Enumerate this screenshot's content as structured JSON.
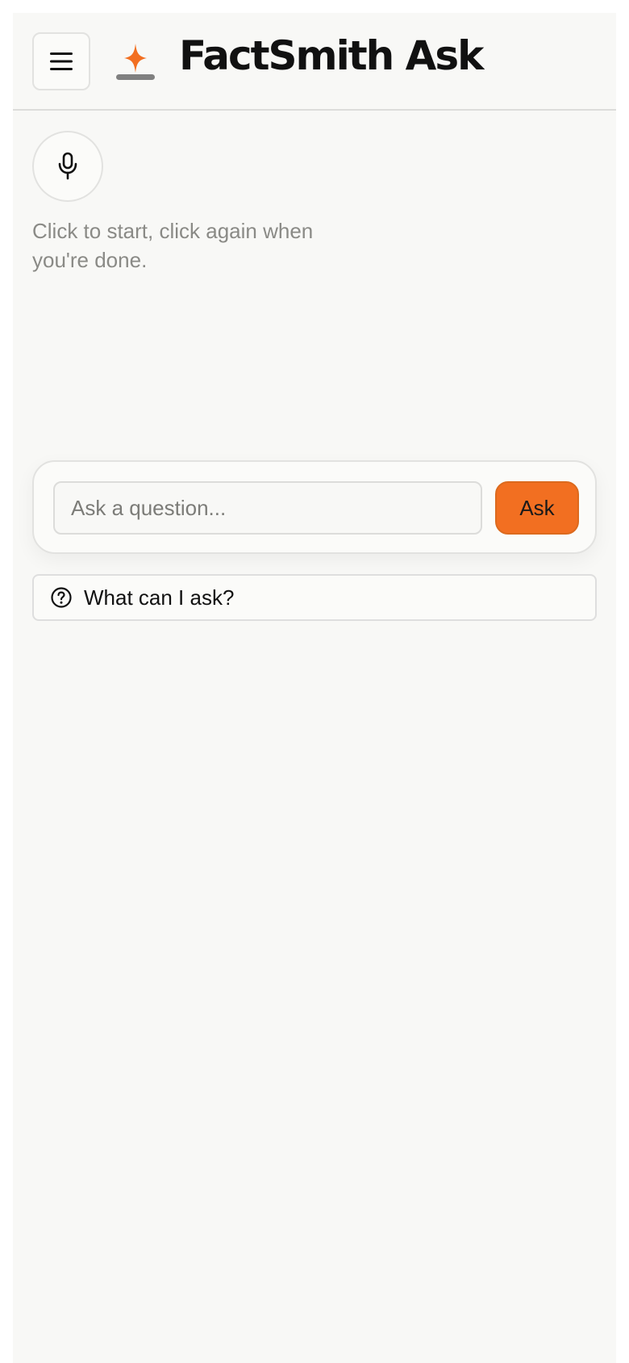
{
  "header": {
    "menu_icon": "hamburger-menu-icon",
    "logo_icon": "sparkle-logo-icon",
    "title": "FactSmith Ask"
  },
  "voice": {
    "mic_icon": "microphone-icon",
    "hint": "Click to start, click again when you're done."
  },
  "ask": {
    "placeholder": "Ask a question...",
    "value": "",
    "button_label": "Ask"
  },
  "help": {
    "icon": "question-circle-icon",
    "label": "What can I ask?"
  },
  "colors": {
    "accent": "#f26f21",
    "background": "#f8f8f6",
    "logo_base": "#808080"
  }
}
